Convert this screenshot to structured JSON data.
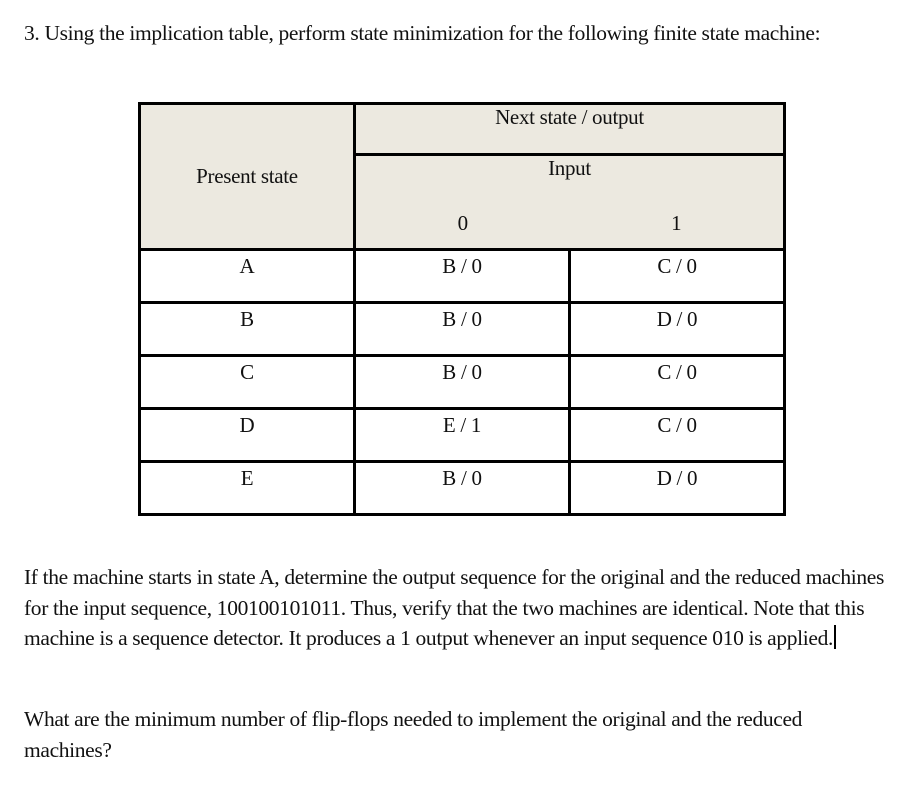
{
  "question": {
    "text": "3. Using the implication table, perform state minimization for the following finite state machine:"
  },
  "table": {
    "header": {
      "present_state": "Present state",
      "next_state_output": "Next state / output",
      "input": "Input",
      "input_values": [
        "0",
        "1"
      ]
    },
    "rows": [
      {
        "state": "A",
        "on0": "B / 0",
        "on1": "C / 0"
      },
      {
        "state": "B",
        "on0": "B / 0",
        "on1": "D / 0"
      },
      {
        "state": "C",
        "on0": "B / 0",
        "on1": "C / 0"
      },
      {
        "state": "D",
        "on0": "E / 1",
        "on1": "C / 0"
      },
      {
        "state": "E",
        "on0": "B / 0",
        "on1": "D / 0"
      }
    ],
    "header_bg_color": "#ece9e0"
  },
  "paragraphs": [
    "If the machine starts in state A, determine the output sequence for the original and the reduced machines for the input sequence, 100100101011. Thus, verify that the two machines are identical. Note that this machine is a sequence detector. It produces a 1 output whenever an input sequence 010 is applied.",
    "What are the minimum number of flip-flops needed to implement the original and the reduced machines?"
  ]
}
